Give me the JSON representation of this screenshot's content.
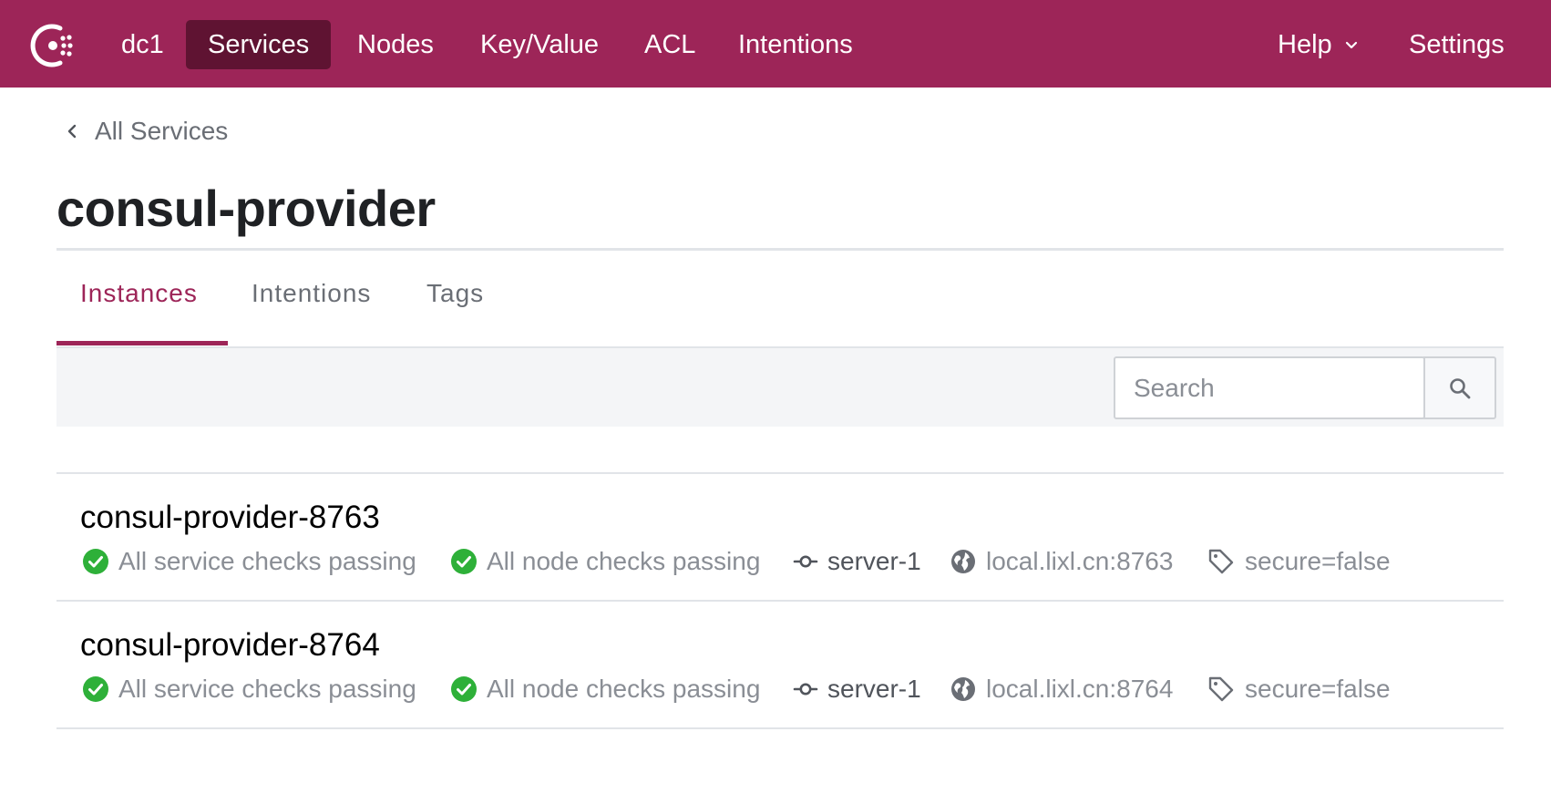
{
  "nav": {
    "datacenter": "dc1",
    "items": [
      "Services",
      "Nodes",
      "Key/Value",
      "ACL",
      "Intentions"
    ],
    "active": "Services",
    "help": "Help",
    "settings": "Settings"
  },
  "breadcrumb": {
    "label": "All Services"
  },
  "service": {
    "title": "consul-provider"
  },
  "tabs": [
    {
      "label": "Instances",
      "active": true
    },
    {
      "label": "Intentions",
      "active": false
    },
    {
      "label": "Tags",
      "active": false
    }
  ],
  "search": {
    "placeholder": "Search",
    "value": ""
  },
  "instances": [
    {
      "name": "consul-provider-8763",
      "service_checks": "All service checks passing",
      "node_checks": "All node checks passing",
      "node": "server-1",
      "address": "local.lixl.cn:8763",
      "tag": "secure=false"
    },
    {
      "name": "consul-provider-8764",
      "service_checks": "All service checks passing",
      "node_checks": "All node checks passing",
      "node": "server-1",
      "address": "local.lixl.cn:8764",
      "tag": "secure=false"
    }
  ],
  "colors": {
    "brand": "#9d2558",
    "nav_active": "#5f1332",
    "passing": "#2eb039",
    "muted_text": "#8a8e95"
  }
}
